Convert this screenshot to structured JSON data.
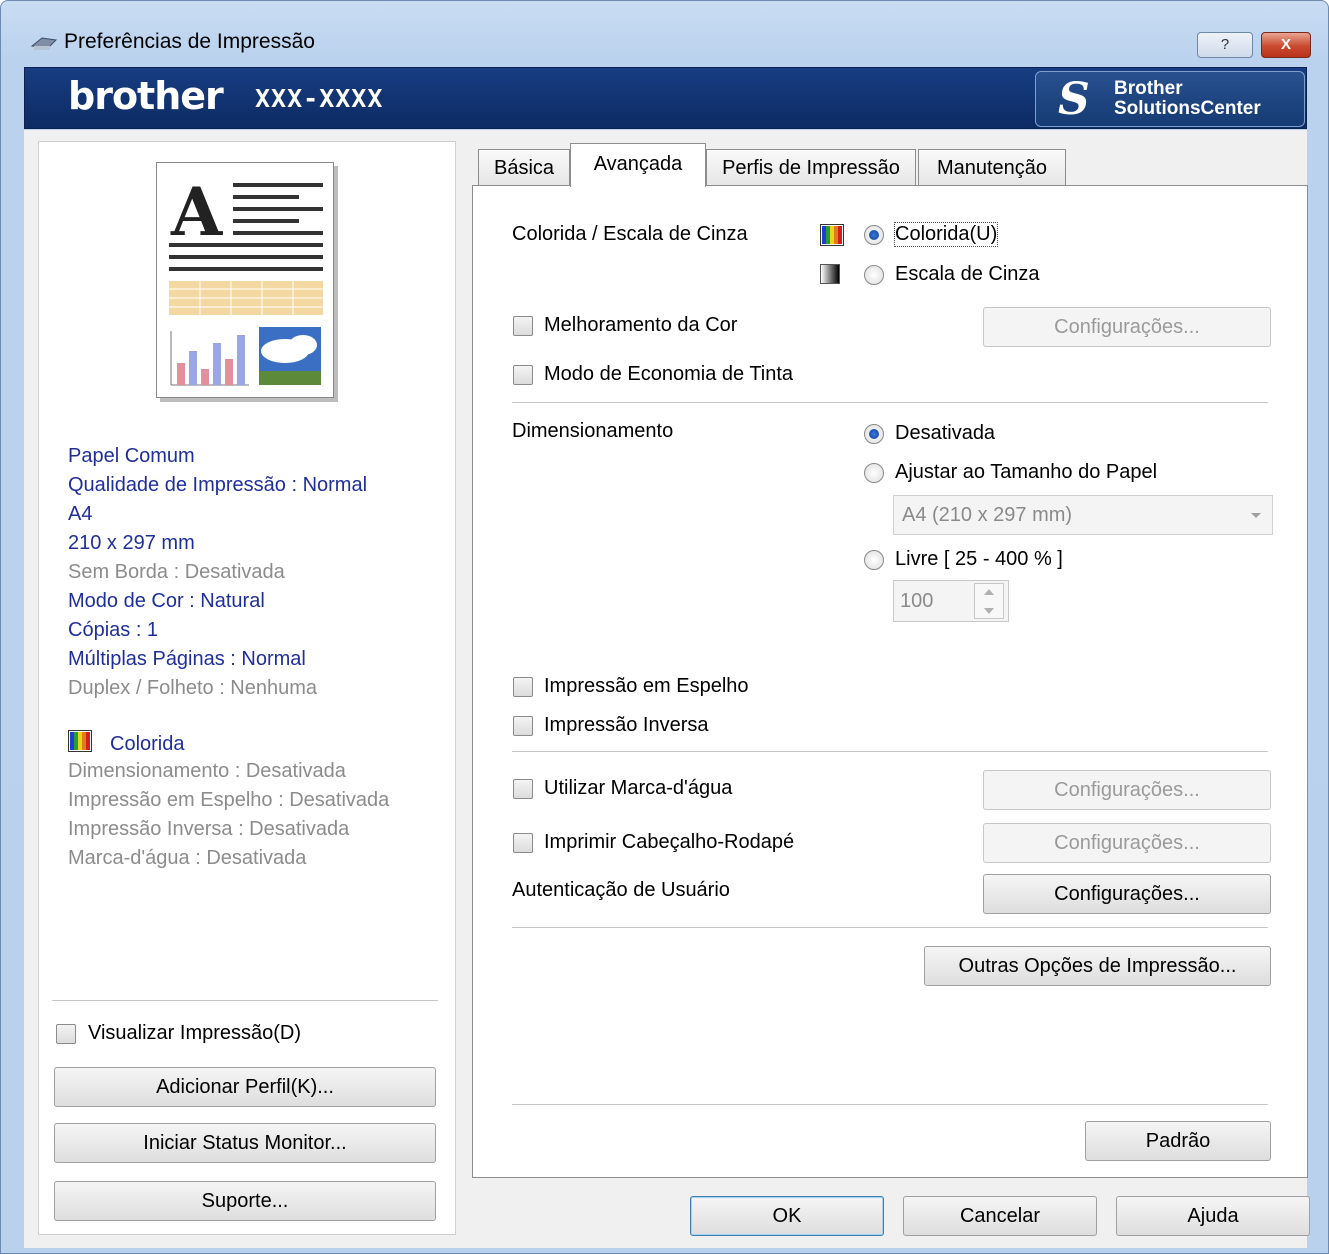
{
  "window": {
    "title": "Preferências de Impressão",
    "help_btn": "?",
    "close_btn": "X"
  },
  "banner": {
    "logo": "brother",
    "model": "XXX-XXXX",
    "solutions_line1": "Brother",
    "solutions_line2": "SolutionsCenter"
  },
  "summary": {
    "items": [
      {
        "text": "Papel Comum",
        "active": true
      },
      {
        "text": "Qualidade de Impressão : Normal",
        "active": true
      },
      {
        "text": "A4",
        "active": true
      },
      {
        "text": "210 x 297 mm",
        "active": true
      },
      {
        "text": "Sem Borda : Desativada",
        "active": false
      },
      {
        "text": "Modo de Cor : Natural",
        "active": true
      },
      {
        "text": "Cópias : 1",
        "active": true
      },
      {
        "text": "Múltiplas Páginas : Normal",
        "active": true
      },
      {
        "text": "Duplex / Folheto : Nenhuma",
        "active": false
      }
    ],
    "color_mode": "Colorida",
    "items2": [
      "Dimensionamento : Desativada",
      "Impressão em Espelho : Desativada",
      "Impressão Inversa : Desativada",
      "Marca-d'água : Desativada"
    ]
  },
  "left_controls": {
    "preview_label": "Visualizar Impressão(D)",
    "add_profile": "Adicionar Perfil(K)...",
    "status_monitor": "Iniciar Status Monitor...",
    "support": "Suporte..."
  },
  "tabs": [
    "Básica",
    "Avançada",
    "Perfis de Impressão",
    "Manutenção"
  ],
  "advanced": {
    "color_gray_label": "Colorida / Escala de Cinza",
    "color_option": "Colorida(U)",
    "gray_option": "Escala de Cinza",
    "color_enhance": "Melhoramento da Cor",
    "ink_save": "Modo de Economia de Tinta",
    "settings": "Configurações...",
    "scaling_label": "Dimensionamento",
    "scaling_off": "Desativada",
    "scaling_fit": "Ajustar ao Tamanho do Papel",
    "paper_size": "A4 (210 x 297 mm)",
    "scaling_free": "Livre [ 25 - 400 % ]",
    "scaling_value": "100",
    "mirror": "Impressão em Espelho",
    "reverse": "Impressão Inversa",
    "watermark": "Utilizar Marca-d'água",
    "header_footer": "Imprimir Cabeçalho-Rodapé",
    "user_auth": "Autenticação de Usuário",
    "other_options": "Outras Opções de Impressão...",
    "default": "Padrão"
  },
  "footer": {
    "ok": "OK",
    "cancel": "Cancelar",
    "help": "Ajuda"
  },
  "colors": {
    "banner": "#173d82",
    "summary_active": "#1f2f9a",
    "summary_inactive": "#8c8c8c"
  }
}
